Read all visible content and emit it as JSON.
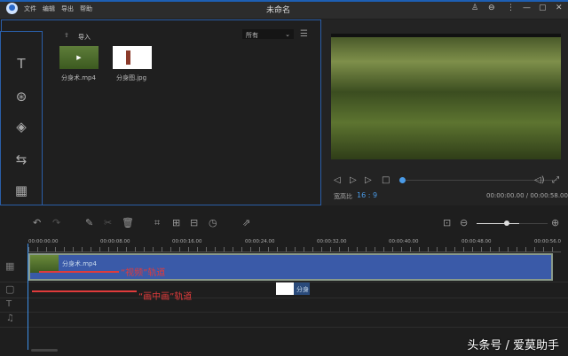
{
  "app": {
    "title": "未命名",
    "menu": [
      "文件",
      "编辑",
      "导出",
      "帮助"
    ]
  },
  "media": {
    "import_label": "导入",
    "filter": "所有",
    "files": [
      {
        "name": "分身术.mp4"
      },
      {
        "name": "分身图.jpg"
      }
    ]
  },
  "preview": {
    "aspect_label": "宽高比",
    "aspect_value": "16 : 9",
    "time": "00:00:00.00 / 00:00:58.00"
  },
  "timeline": {
    "ticks": [
      "00:00:00.00",
      "00:00:08.00",
      "00:00:16.00",
      "00:00:24.00",
      "00:00:32.00",
      "00:00:40.00",
      "00:00:48.00",
      "00:00:56.0"
    ],
    "video_clip": "分身术.mp4",
    "pip_clip": "分身",
    "zoom_level": 0.6
  },
  "annotations": {
    "video_track": "“视频”轨道",
    "pip_track": "“画中画”轨道"
  },
  "watermark": "头条号 / 爱莫助手"
}
